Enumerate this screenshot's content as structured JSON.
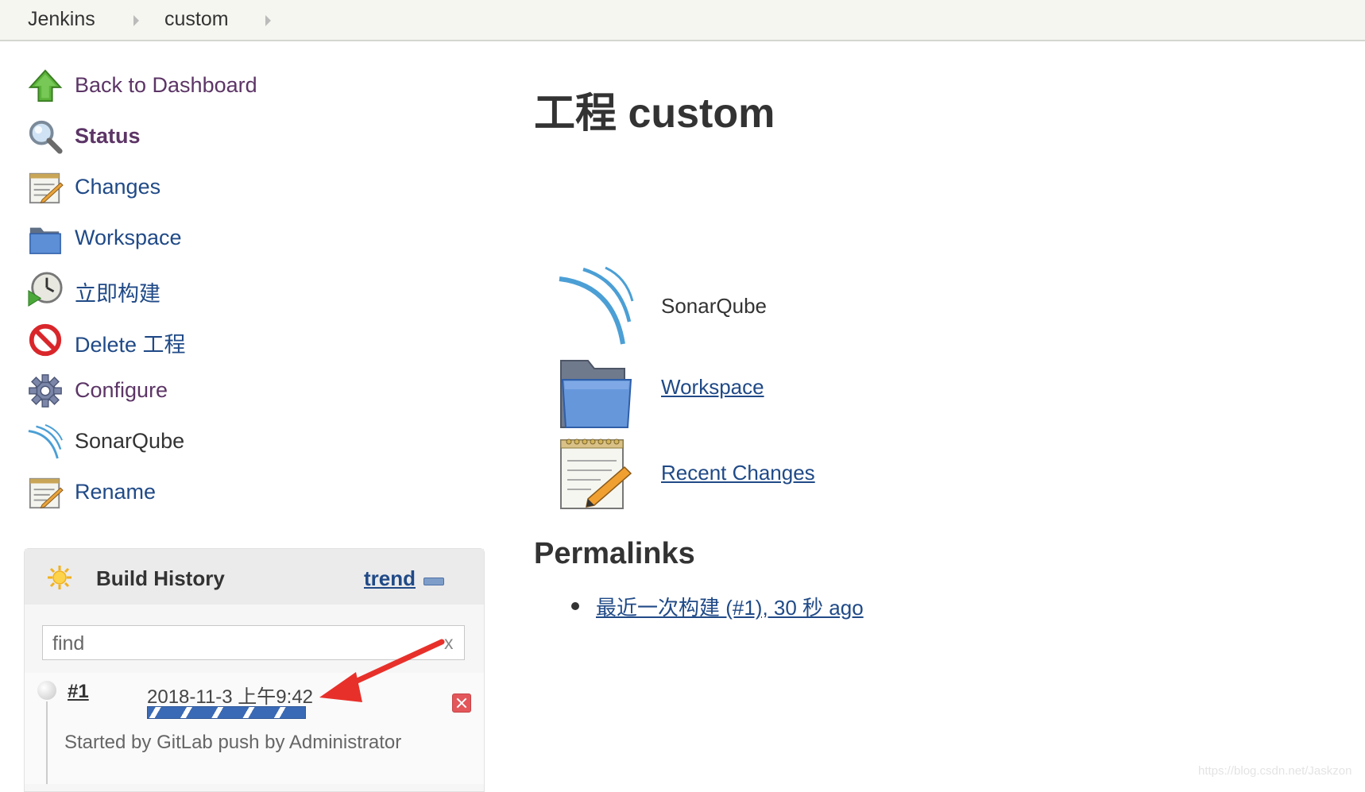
{
  "breadcrumb": {
    "items": [
      "Jenkins",
      "custom"
    ]
  },
  "sidebar": {
    "items": [
      {
        "label": "Back to Dashboard",
        "icon": "up-arrow-icon"
      },
      {
        "label": "Status",
        "icon": "magnifier-icon"
      },
      {
        "label": "Changes",
        "icon": "notepad-icon"
      },
      {
        "label": "Workspace",
        "icon": "folder-icon"
      },
      {
        "label": "立即构建",
        "icon": "clock-play-icon"
      },
      {
        "label": "Delete 工程",
        "icon": "no-entry-icon"
      },
      {
        "label": "Configure",
        "icon": "gear-icon"
      },
      {
        "label": "SonarQube",
        "icon": "sonarqube-icon"
      },
      {
        "label": "Rename",
        "icon": "notepad-icon"
      }
    ]
  },
  "build_history": {
    "title": "Build History",
    "trend": "trend",
    "find_placeholder": "find",
    "clear": "x",
    "builds": [
      {
        "number": "#1",
        "date": "2018-11-3 上午9:42",
        "cause": "Started by GitLab push by Administrator",
        "status": "in-progress"
      }
    ]
  },
  "main": {
    "title": "工程 custom",
    "links": [
      {
        "label": "SonarQube",
        "icon": "sonarqube-icon"
      },
      {
        "label": "Workspace",
        "icon": "folder-icon"
      },
      {
        "label": "Recent Changes",
        "icon": "notepad-icon"
      }
    ],
    "permalinks_heading": "Permalinks",
    "permalinks": [
      "最近一次构建 (#1), 30 秒 ago"
    ]
  },
  "watermark": "https://blog.csdn.net/Jaskzon",
  "colors": {
    "link": "#204a87",
    "visited": "#5c3566",
    "breadcrumb_bg": "#f6f6f1",
    "annotation_arrow": "#e8302a",
    "progress_fill": "#3a6ab5"
  }
}
